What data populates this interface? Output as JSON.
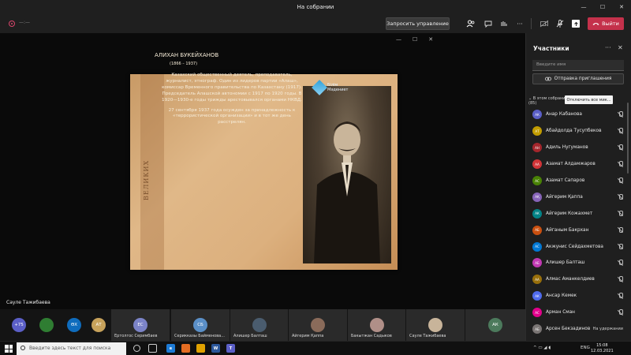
{
  "window": {
    "title": "На собрании",
    "controls": [
      "—",
      "☐",
      "✕"
    ]
  },
  "toolbar": {
    "timer": "—:—",
    "request_control": "Запросить управление",
    "leave": "Выйти"
  },
  "stage_controls": [
    "—",
    "☐",
    "✕"
  ],
  "presenter": "Сауле Тажибаева",
  "slide": {
    "band_text": "ВЕЛИКИХ",
    "title": "АЛИХАН БУКЕЙХАНОВ",
    "years": "(1866 – 1937)",
    "logo": [
      "Білім",
      "Мәдениет"
    ],
    "paragraph1": "Казахский общественный деятель, преподаватель, журналист, этнограф. Один из лидеров партии «Алаш», комиссар Временного правительства по Казахстану (1917). Председатель Алашской автономии с 1917 по 1920 годы. В 1920—1930-е годы трижды арестовывался органами НКВД.",
    "paragraph2": "27 сентября 1937 года осужден за принадлежность к «террористической организации» и в тот же день расстрелян."
  },
  "panel": {
    "title": "Участники",
    "search_placeholder": "Введите имя",
    "invite": "Отправка приглашения",
    "section": "В этом собрании",
    "section_count": "(85)",
    "mute_all": "Отключить все мик...",
    "participants": [
      {
        "initials": "АК",
        "name": "Анар Кабанова",
        "color": "#5b5fc7",
        "status": "mic-off"
      },
      {
        "initials": "АТ",
        "name": "Абайдолда Тусупбеков",
        "color": "#c19c00",
        "status": "mic-off"
      },
      {
        "initials": "АН",
        "name": "Адиль Нугуманов",
        "color": "#a4262c",
        "status": "mic-off"
      },
      {
        "initials": "АА",
        "name": "Азамат Алдамжаров",
        "color": "#d13438",
        "status": "mic-off"
      },
      {
        "initials": "АС",
        "name": "Азамат Сапаров",
        "color": "#498205",
        "status": "mic-off"
      },
      {
        "initials": "АҚ",
        "name": "Айгерим Қаппа",
        "color": "#8764b8",
        "status": "mic-off"
      },
      {
        "initials": "АК",
        "name": "Айгерим Кожахмет",
        "color": "#038387",
        "status": "mic-off"
      },
      {
        "initials": "АБ",
        "name": "Айганым Бакрхан",
        "color": "#ca5010",
        "status": "mic-off"
      },
      {
        "initials": "АС",
        "name": "Акжунис Сейдахметова",
        "color": "#0078d4",
        "status": "mic-off"
      },
      {
        "initials": "АБ",
        "name": "Алишер Балташ",
        "color": "#c239b3",
        "status": "mic-off"
      },
      {
        "initials": "АА",
        "name": "Алмас Аманкелдиев",
        "color": "#986f0b",
        "status": "mic-off"
      },
      {
        "initials": "АК",
        "name": "Ансар Кемек",
        "color": "#4f6bed",
        "status": "mic-off"
      },
      {
        "initials": "АС",
        "name": "Арман Сман",
        "color": "#e3008c",
        "status": "mic-off"
      },
      {
        "initials": "АБ",
        "name": "Арсен Бекзадинов",
        "color": "#7a7574",
        "status": "На удержании"
      }
    ]
  },
  "gallery": [
    {
      "initials": "+75",
      "name": "",
      "color": "#5b5fc7"
    },
    {
      "initials": "",
      "name": "",
      "color": "#2f7d32"
    },
    {
      "initials": "ӨХ",
      "name": "",
      "color": "#0f6cbd"
    },
    {
      "initials": "АТ",
      "name": "",
      "color": "#c7a25b"
    },
    {
      "initials": "ЕС",
      "name": "Ертолгос Серимбаев",
      "color": "#7b83c7"
    },
    {
      "initials": "СБ",
      "name": "Серикказы Байменова...",
      "color": "#5a8fc7"
    },
    {
      "initials": "",
      "name": "Алишер Балташ",
      "color": "#4a5c6e"
    },
    {
      "initials": "",
      "name": "Айгерим Қаппа",
      "color": "#8a6b5a"
    },
    {
      "initials": "",
      "name": "Бакытжан Садыков",
      "color": "#b08f88"
    },
    {
      "initials": "",
      "name": "Сауле Тажибаева",
      "color": "#c8b49a"
    },
    {
      "initials": "АК",
      "name": "",
      "color": "#4c7a5c"
    }
  ],
  "taskbar": {
    "search_placeholder": "Введите здесь текст для поиска",
    "lang": "ENG",
    "time": "15:08",
    "date": "12.03.2021",
    "apps": [
      {
        "label": "e",
        "color": "#1d7bd6",
        "name": "edge-icon"
      },
      {
        "label": "",
        "color": "#e46c22",
        "name": "firefox-icon"
      },
      {
        "label": "",
        "color": "#e0a100",
        "name": "folder-icon"
      },
      {
        "label": "W",
        "color": "#2b579a",
        "name": "word-icon"
      },
      {
        "label": "T",
        "color": "#5b5fc7",
        "name": "teams-icon"
      }
    ]
  }
}
